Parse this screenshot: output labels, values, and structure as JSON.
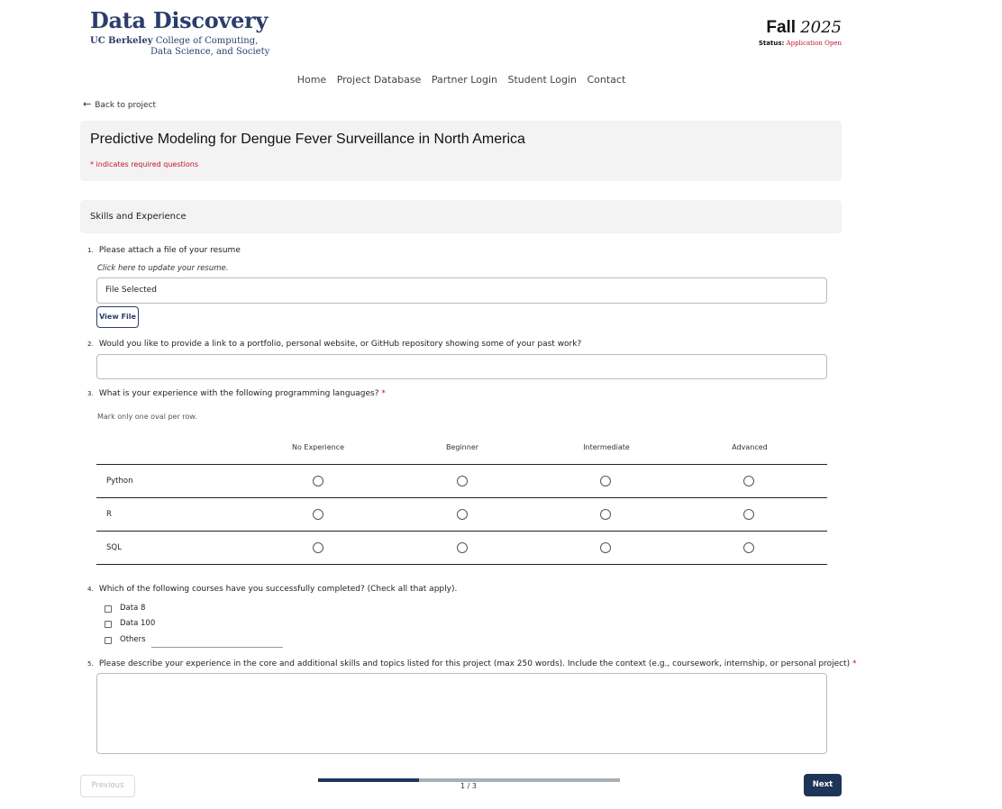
{
  "header": {
    "logo_title": "Data Discovery",
    "logo_org": "UC Berkeley",
    "logo_sub1": " College of Computing,",
    "logo_sub2": "Data Science, and Society",
    "term_season": "Fall",
    "term_year": "2025",
    "status_label": "Status:",
    "status_value": "Application Open"
  },
  "nav": {
    "items": [
      "Home",
      "Project Database",
      "Partner Login",
      "Student Login",
      "Contact"
    ]
  },
  "back_link": "Back to project",
  "form": {
    "title": "Predictive Modeling for Dengue Fever Surveillance in North America",
    "required_note": "* indicates required questions",
    "section_title": "Skills and Experience",
    "q1": {
      "num": "1.",
      "text": "Please attach a file of your resume",
      "hint": "Click here to update your resume.",
      "value": "File Selected",
      "button": "View File"
    },
    "q2": {
      "num": "2.",
      "text": "Would you like to provide a link to a portfolio, personal website, or GitHub repository showing some of your past work?",
      "value": ""
    },
    "q3": {
      "num": "3.",
      "text": "What is your experience with the following programming languages?",
      "required_mark": "*",
      "hint": "Mark only one oval per row.",
      "columns": [
        "No Experience",
        "Beginner",
        "Intermediate",
        "Advanced"
      ],
      "rows": [
        "Python",
        "R",
        "SQL"
      ]
    },
    "q4": {
      "num": "4.",
      "text": "Which of the following courses have you successfully completed? (Check all that apply).",
      "options": [
        "Data 8",
        "Data 100",
        "Others"
      ]
    },
    "q5": {
      "num": "5.",
      "text": "Please describe your experience in the core and additional skills and topics listed for this project (max 250 words). Include the context (e.g., coursework, internship, or personal project)",
      "required_mark": "*",
      "value": ""
    }
  },
  "footer": {
    "previous": "Previous",
    "next": "Next",
    "progress_text": "1 / 3",
    "progress_fraction": 0.333
  },
  "colors": {
    "brand_navy": "#2b3d6b",
    "button_navy": "#1d3557",
    "required_red": "#c41230",
    "card_gray": "#f3f3f3"
  }
}
